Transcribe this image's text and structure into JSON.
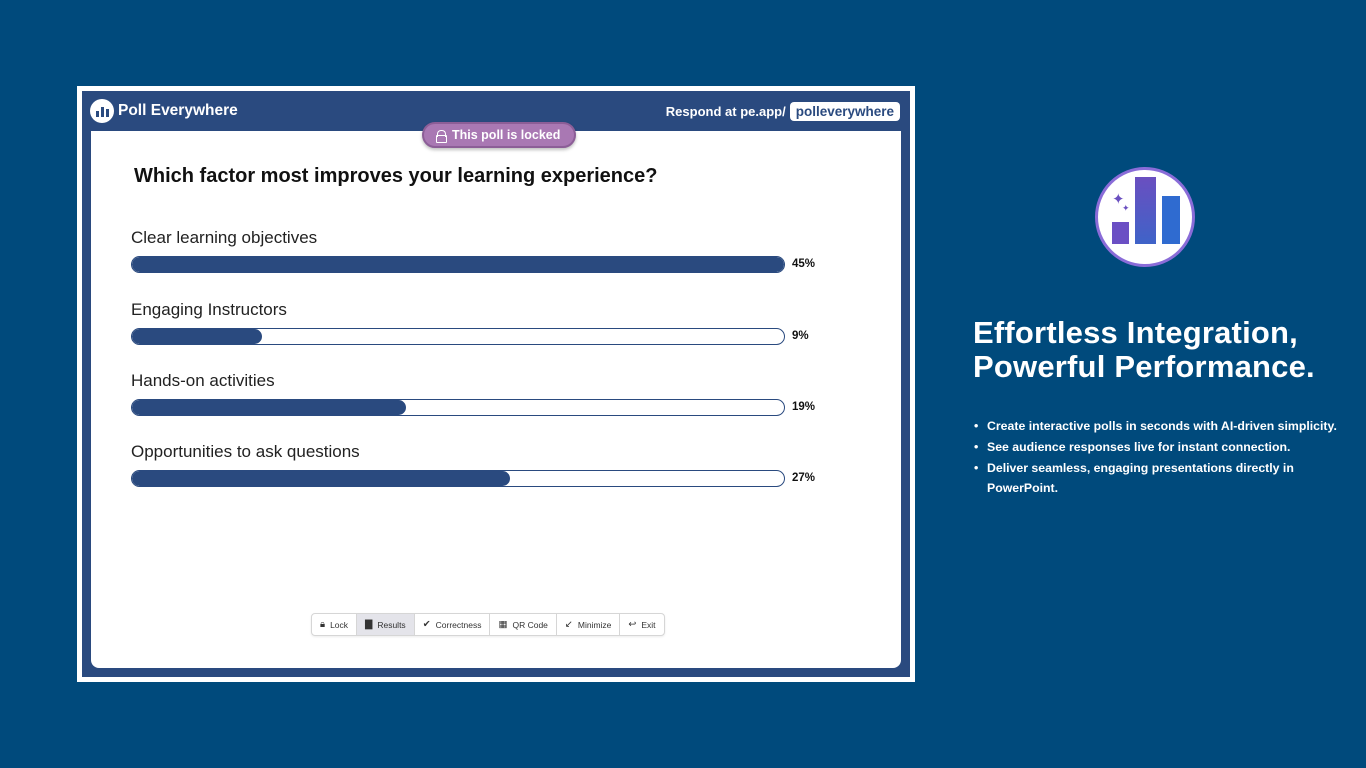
{
  "brand": {
    "name": "Poll Everywhere"
  },
  "header": {
    "respond_prefix": "Respond at pe.app/",
    "respond_code": "polleverywhere"
  },
  "poll": {
    "lock_status": "This poll is locked",
    "question": "Which factor most improves your learning experience?",
    "options": [
      {
        "label": "Clear learning objectives",
        "percent": 45,
        "percent_label": "45%",
        "bar_fill_fraction": 1.0
      },
      {
        "label": "Engaging Instructors",
        "percent": 9,
        "percent_label": "9%",
        "bar_fill_fraction": 0.2
      },
      {
        "label": "Hands-on activities",
        "percent": 19,
        "percent_label": "19%",
        "bar_fill_fraction": 0.42
      },
      {
        "label": "Opportunities to ask questions",
        "percent": 27,
        "percent_label": "27%",
        "bar_fill_fraction": 0.58
      }
    ]
  },
  "toolbar": {
    "buttons": [
      {
        "label": "Lock",
        "icon": "lock-icon",
        "active": false
      },
      {
        "label": "Results",
        "icon": "bar-chart-icon",
        "active": true
      },
      {
        "label": "Correctness",
        "icon": "check-circle-icon",
        "active": false
      },
      {
        "label": "QR Code",
        "icon": "qr-code-icon",
        "active": false
      },
      {
        "label": "Minimize",
        "icon": "minimize-icon",
        "active": false
      },
      {
        "label": "Exit",
        "icon": "exit-icon",
        "active": false
      }
    ]
  },
  "promo": {
    "headline_line1": "Effortless Integration,",
    "headline_line2": "Powerful Performance.",
    "bullets": [
      "Create interactive polls in seconds with AI-driven simplicity.",
      "See audience responses live for instant connection.",
      "Deliver seamless, engaging presentations directly in PowerPoint."
    ]
  },
  "colors": {
    "page_background": "#004a7c",
    "frame_navy": "#2a4a7f",
    "bar_fill": "#2a4a7f",
    "lock_pill": "#a978b3",
    "logo_ring": "#8a6cd8"
  }
}
